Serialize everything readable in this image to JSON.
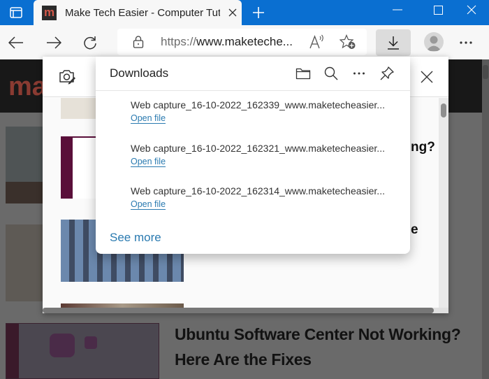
{
  "browser": {
    "tab": {
      "favicon_letter": "m",
      "title": "Make Tech Easier - Computer Tutorials"
    },
    "address_bar": {
      "url_prefix": "https://",
      "url_host": "www.maketeche..."
    },
    "colors": {
      "titlebar": "#0a6fd1",
      "link": "#2a7ab0"
    }
  },
  "page": {
    "logo_text": "ma",
    "article_title": "Ubuntu Software Center Not Working? Here Are the Fixes"
  },
  "web_capture": {
    "partial_titles": [
      "ng?",
      "e"
    ]
  },
  "downloads": {
    "title": "Downloads",
    "items": [
      {
        "name": "Web capture_16-10-2022_162339_www.maketecheasier...",
        "action": "Open file"
      },
      {
        "name": "Web capture_16-10-2022_162321_www.maketecheasier...",
        "action": "Open file"
      },
      {
        "name": "Web capture_16-10-2022_162314_www.maketecheasier...",
        "action": "Open file"
      }
    ],
    "see_more": "See more"
  }
}
